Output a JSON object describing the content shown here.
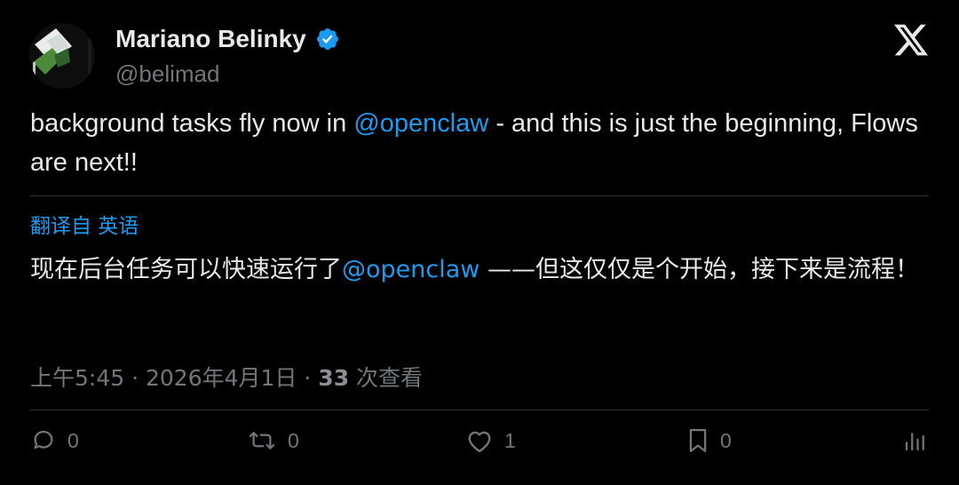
{
  "author": {
    "display_name": "Mariano Belinky",
    "handle": "@belimad",
    "verified_icon": "verified-badge-icon"
  },
  "brand": {
    "logo_icon": "x-logo-icon"
  },
  "tweet": {
    "text_before": "background tasks fly now in ",
    "mention": "@openclaw",
    "text_after": " - and this is just the beginning,  Flows are next!!"
  },
  "translation": {
    "label": "翻译自 英语",
    "text_before": "现在后台任务可以快速运行了",
    "mention": "@openclaw",
    "text_after": " ——但这仅仅是个开始，接下来是流程！"
  },
  "meta": {
    "time": "上午5:45",
    "separator": "·",
    "date": "2026年4月1日",
    "views_count": "33",
    "views_label": "次查看"
  },
  "actions": {
    "reply_count": "0",
    "retweet_count": "0",
    "like_count": "1",
    "bookmark_count": "0"
  },
  "colors": {
    "background": "#000000",
    "text": "#e7e9ea",
    "secondary": "#71767b",
    "accent": "#1d9bf0",
    "divider": "#2f3336"
  }
}
